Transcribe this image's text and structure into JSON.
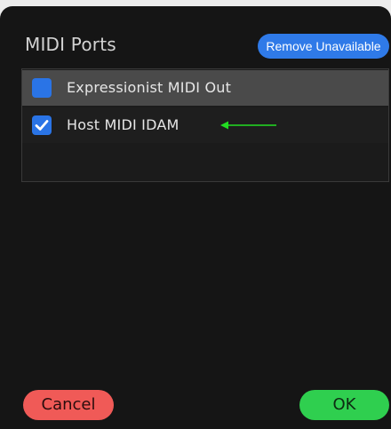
{
  "dialog": {
    "title": "MIDI Ports",
    "remove_unavailable_label": "Remove Unavailable"
  },
  "ports": [
    {
      "name": "Expressionist MIDI Out",
      "checked": false
    },
    {
      "name": "Host MIDI IDAM",
      "checked": true
    }
  ],
  "footer": {
    "cancel_label": "Cancel",
    "ok_label": "OK"
  },
  "colors": {
    "accent_blue": "#2f7ae8",
    "cancel_red": "#f05a57",
    "ok_green": "#2fcf4f",
    "annotation_arrow": "#22dd22"
  },
  "icons": {
    "checkmark": "checkmark-icon",
    "arrow": "arrow-left-icon"
  }
}
